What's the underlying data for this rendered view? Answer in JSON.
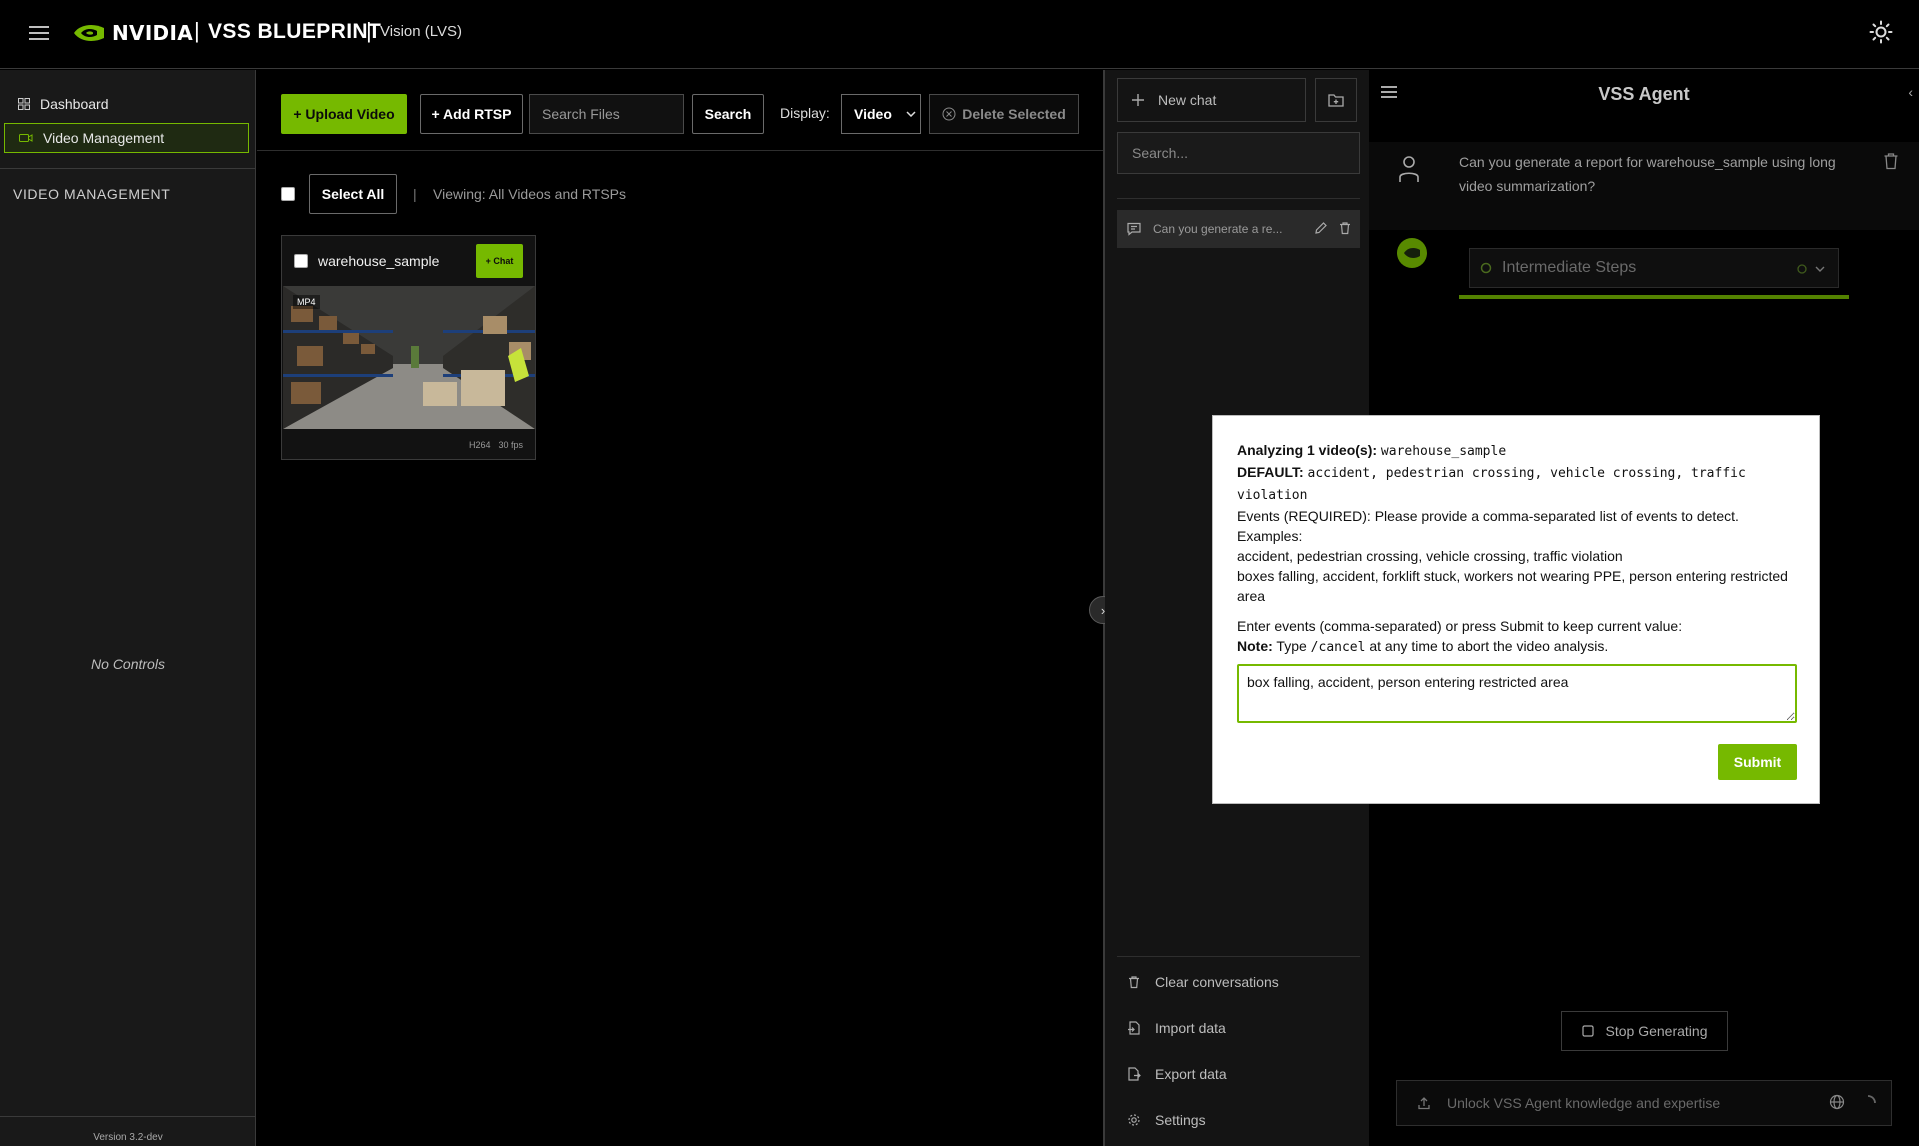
{
  "header": {
    "logo_text": "NVIDIA",
    "title": "VSS BLUEPRINT",
    "subtitle": "Vision (LVS)"
  },
  "sidebar": {
    "items": [
      {
        "label": "Dashboard",
        "icon": "dashboard-icon"
      },
      {
        "label": "Video Management",
        "icon": "camera-icon",
        "active": true
      }
    ],
    "section_heading": "VIDEO MANAGEMENT",
    "empty_text": "No Controls",
    "version": "Version 3.2-dev"
  },
  "toolbar": {
    "upload_label": "+ Upload Video",
    "rtsp_label": "+ Add RTSP",
    "search_placeholder": "Search Files",
    "search_label": "Search",
    "display_label": "Display:",
    "display_value": "Video",
    "delete_label": "Delete Selected"
  },
  "selection": {
    "select_all_label": "Select All",
    "separator": "|",
    "viewing_text": "Viewing: All Videos and RTSPs"
  },
  "videos": [
    {
      "name": "warehouse_sample",
      "chat_label": "+ Chat",
      "format": "MP4",
      "codec": "H264",
      "fps": "30 fps"
    }
  ],
  "history": {
    "new_chat_label": "New chat",
    "search_placeholder": "Search...",
    "items": [
      {
        "label": "Can you generate a re..."
      }
    ],
    "footer": [
      {
        "label": "Clear conversations",
        "icon": "trash-icon"
      },
      {
        "label": "Import data",
        "icon": "import-icon"
      },
      {
        "label": "Export data",
        "icon": "export-icon"
      },
      {
        "label": "Settings",
        "icon": "gear-icon"
      }
    ]
  },
  "agent": {
    "title": "VSS Agent",
    "user_message": "Can you generate a report for warehouse_sample using long video summarization?",
    "steps_label": "Intermediate Steps",
    "stop_label": "Stop Generating",
    "input_placeholder": "Unlock VSS Agent knowledge and expertise"
  },
  "modal": {
    "analyzing_label": "Analyzing 1 video(s):",
    "analyzing_value": "warehouse_sample",
    "default_label": "DEFAULT:",
    "default_value": "accident, pedestrian crossing, vehicle crossing, traffic violation",
    "events_required": "Events (REQUIRED): Please provide a comma-separated list of events to detect.",
    "examples_label": "Examples:",
    "example_1": "accident, pedestrian crossing, vehicle crossing, traffic violation",
    "example_2": "boxes falling, accident, forklift stuck, workers not wearing PPE, person entering restricted area",
    "enter_prompt": "Enter events (comma-separated) or press Submit to keep current value:",
    "note_label": "Note:",
    "note_pre": "Type",
    "note_code": "/cancel",
    "note_post": "at any time to abort the video analysis.",
    "input_value": "box falling, accident, person entering restricted area",
    "submit_label": "Submit"
  },
  "colors": {
    "accent": "#76b900",
    "background": "#000000",
    "panel": "#141414"
  }
}
